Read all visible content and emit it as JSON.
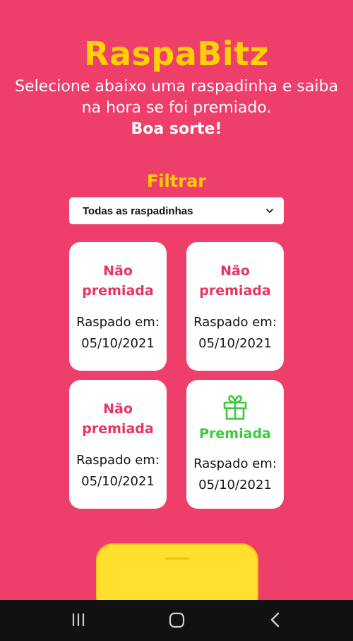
{
  "app": {
    "title": "RaspaBitz",
    "subtitle": "Selecione abaixo uma raspadinha e saiba na hora se foi premiado.",
    "subtitle_emphasis": "Boa sorte!"
  },
  "filter": {
    "label": "Filtrar",
    "selected": "Todas as raspadinhas",
    "icon": "chevron-down-icon"
  },
  "cards": [
    {
      "status_line1": "Não",
      "status_line2": "premiada",
      "date_label": "Raspado em:",
      "date": "05/10/2021"
    },
    {
      "status_line1": "Não",
      "status_line2": "premiada",
      "date_label": "Raspado em:",
      "date": "05/10/2021"
    },
    {
      "status_line1": "Não",
      "status_line2": "premiada",
      "date_label": "Raspado em:",
      "date": "05/10/2021"
    },
    {
      "status": "Premiada",
      "icon": "gift-icon",
      "date_label": "Raspado em:",
      "date": "05/10/2021"
    }
  ],
  "colors": {
    "background": "#ee3e6a",
    "brand_yellow": "#ffd100",
    "loss": "#e8345f",
    "win": "#3cc93c",
    "navbar": "#111111"
  },
  "navbar": {
    "icons": [
      "recent-apps-icon",
      "home-icon",
      "back-icon"
    ]
  }
}
